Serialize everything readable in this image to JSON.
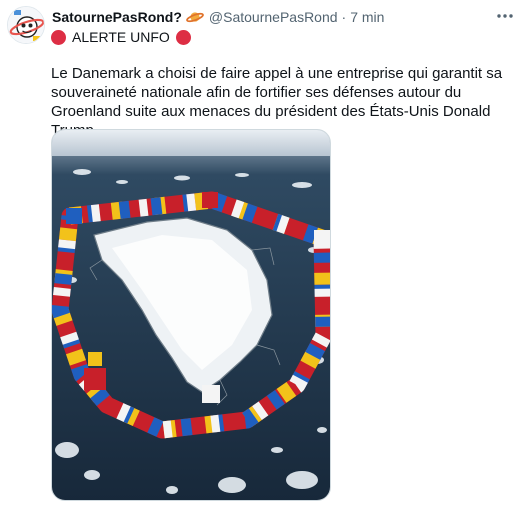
{
  "tweet": {
    "display_name": "SatournePasRond?",
    "handle": "@SatournePasRond",
    "separator": "·",
    "time": "7 min",
    "alert_label": "ALERTE UNFO",
    "text": "Le Danemark a choisi de faire appel à une entreprise qui garantit sa souveraineté nationale afin de fortifier ses défenses autour du Groenland suite aux menaces du président des États-Unis Donald Trump."
  },
  "icons": {
    "saturn": "saturn-icon",
    "alert": "red-circle-icon",
    "more": "more-icon"
  },
  "colors": {
    "text": "#0f1419",
    "secondary": "#536471",
    "alert_red": "#dd2e44"
  }
}
